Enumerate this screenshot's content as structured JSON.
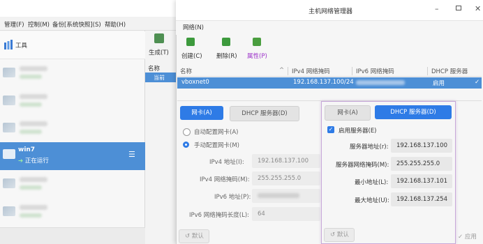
{
  "vbox": {
    "menu": [
      "管理(F)",
      "控制(M)",
      "备份[系统快照](S)",
      "帮助(H)"
    ],
    "tools_label": "工具",
    "generate_label": "生成(T)",
    "name_column": "名称",
    "list_row_text": "当前",
    "selected_vm": {
      "name": "win7",
      "state": "正在运行"
    }
  },
  "hnm": {
    "title": "主机网络管理器",
    "menu_network": "网络(N)",
    "toolbar": {
      "create": "创建(C)",
      "delete": "删除(R)",
      "properties": "属性(P)"
    },
    "table": {
      "headers": [
        "名称",
        "IPv4 网络掩码",
        "IPv6 网络掩码",
        "DHCP 服务器"
      ],
      "row": {
        "name": "vboxnet0",
        "ipv4": "192.168.137.100/24",
        "dhcp": "启用"
      }
    },
    "nic_tabs": {
      "adapter": "网卡(A)",
      "dhcp": "DHCP 服务器(D)"
    },
    "adapter": {
      "auto_config": "自动配置网卡(A)",
      "manual_config": "手动配置网卡(M)",
      "ipv4_address_label": "IPv4 地址(I):",
      "ipv4_address": "192.168.137.100",
      "ipv4_mask_label": "IPv4 网络掩码(M):",
      "ipv4_mask": "255.255.255.0",
      "ipv6_address_label": "IPv6 地址(P):",
      "ipv6_prefix_label": "IPv6 网络掩码长度(L):",
      "ipv6_prefix": "64"
    },
    "dhcp": {
      "enable_label": "启用服务器(E)",
      "server_address_label": "服务器地址(r):",
      "server_address": "192.168.137.100",
      "server_mask_label": "服务器网络掩码(M):",
      "server_mask": "255.255.255.0",
      "lower_label": "最小地址(L):",
      "lower": "192.168.137.101",
      "upper_label": "最大地址(U):",
      "upper": "192.168.137.254"
    },
    "reset_label": "默认",
    "apply_label": "应用"
  }
}
